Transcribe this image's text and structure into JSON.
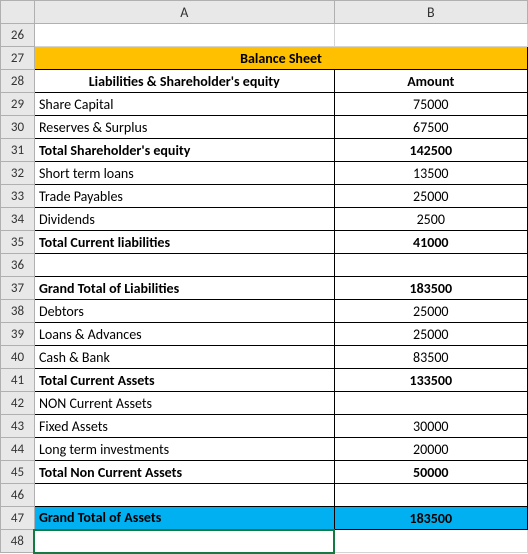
{
  "columns": {
    "A": "A",
    "B": "B"
  },
  "rows": [
    "26",
    "27",
    "28",
    "29",
    "30",
    "31",
    "32",
    "33",
    "34",
    "35",
    "36",
    "37",
    "38",
    "39",
    "40",
    "41",
    "42",
    "43",
    "44",
    "45",
    "46",
    "47",
    "48"
  ],
  "title": "Balance Sheet",
  "h_liab": "Liabilities & Shareholder's equity",
  "h_amt": "Amount",
  "r29a": "Share Capital",
  "r29b": "75000",
  "r30a": "Reserves & Surplus",
  "r30b": "67500",
  "r31a": "Total Shareholder's equity",
  "r31b": "142500",
  "r32a": "Short term loans",
  "r32b": "13500",
  "r33a": "Trade Payables",
  "r33b": "25000",
  "r34a": "Dividends",
  "r34b": "2500",
  "r35a": "Total Current liabilities",
  "r35b": "41000",
  "r37a": "Grand Total of Liabilities",
  "r37b": "183500",
  "r38a": "Debtors",
  "r38b": "25000",
  "r39a": "Loans & Advances",
  "r39b": "25000",
  "r40a": "Cash & Bank",
  "r40b": "83500",
  "r41a": "Total Current Assets",
  "r41b": "133500",
  "r42a": "NON Current Assets",
  "r42b": "",
  "r43a": "Fixed Assets",
  "r43b": "30000",
  "r44a": "Long term investments",
  "r44b": "20000",
  "r45a": "Total Non Current Assets",
  "r45b": "50000",
  "r47a": "Grand Total of Assets",
  "r47b": "183500",
  "chart_data": {
    "type": "table",
    "title": "Balance Sheet",
    "columns": [
      "Liabilities & Shareholder's equity",
      "Amount"
    ],
    "rows": [
      {
        "label": "Share Capital",
        "amount": 75000
      },
      {
        "label": "Reserves & Surplus",
        "amount": 67500
      },
      {
        "label": "Total Shareholder's equity",
        "amount": 142500,
        "total": true
      },
      {
        "label": "Short term loans",
        "amount": 13500
      },
      {
        "label": "Trade Payables",
        "amount": 25000
      },
      {
        "label": "Dividends",
        "amount": 2500
      },
      {
        "label": "Total Current liabilities",
        "amount": 41000,
        "total": true
      },
      {
        "label": "Grand Total of Liabilities",
        "amount": 183500,
        "total": true
      },
      {
        "label": "Debtors",
        "amount": 25000
      },
      {
        "label": "Loans & Advances",
        "amount": 25000
      },
      {
        "label": "Cash & Bank",
        "amount": 83500
      },
      {
        "label": "Total Current Assets",
        "amount": 133500,
        "total": true
      },
      {
        "label": "NON Current Assets",
        "amount": null
      },
      {
        "label": "Fixed Assets",
        "amount": 30000
      },
      {
        "label": "Long term investments",
        "amount": 20000
      },
      {
        "label": "Total Non Current Assets",
        "amount": 50000,
        "total": true
      },
      {
        "label": "Grand Total of Assets",
        "amount": 183500,
        "total": true
      }
    ]
  }
}
